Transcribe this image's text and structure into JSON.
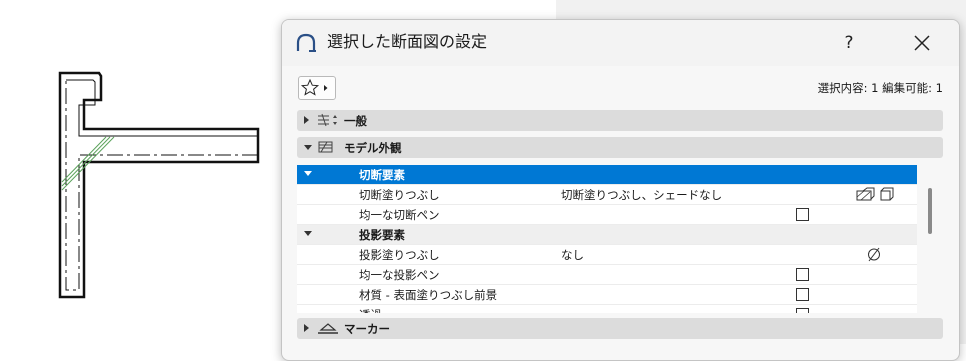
{
  "dialog": {
    "title": "選択した断面図の設定",
    "help_label": "?",
    "status_text": "選択内容: 1 編集可能: 1"
  },
  "sections": [
    {
      "label": "一般",
      "expanded": false,
      "icon": "general-settings-icon"
    },
    {
      "label": "モデル外観",
      "expanded": true,
      "icon": "model-appearance-icon"
    },
    {
      "label": "マーカー",
      "expanded": false,
      "icon": "marker-icon"
    }
  ],
  "rows": [
    {
      "name": "切断要素",
      "type": "group",
      "selected": true
    },
    {
      "name": "切断塗りつぶし",
      "value": "切断塗りつぶし、シェードなし",
      "type": "item",
      "trailing": "fill-style-icons"
    },
    {
      "name": "均一な切断ペン",
      "type": "item",
      "checkbox": false
    },
    {
      "name": "投影要素",
      "type": "group"
    },
    {
      "name": "投影塗りつぶし",
      "value": "なし",
      "type": "item",
      "trailing": "empty-set-icon"
    },
    {
      "name": "均一な投影ペン",
      "type": "item",
      "checkbox": false
    },
    {
      "name": "材質 - 表面塗りつぶし前景",
      "type": "item",
      "checkbox": false
    },
    {
      "name": "透過",
      "type": "item",
      "checkbox": false
    }
  ],
  "colors": {
    "selection": "#0078d4",
    "section_bg": "#dcdcdc",
    "hatch": "#5ca35c"
  }
}
